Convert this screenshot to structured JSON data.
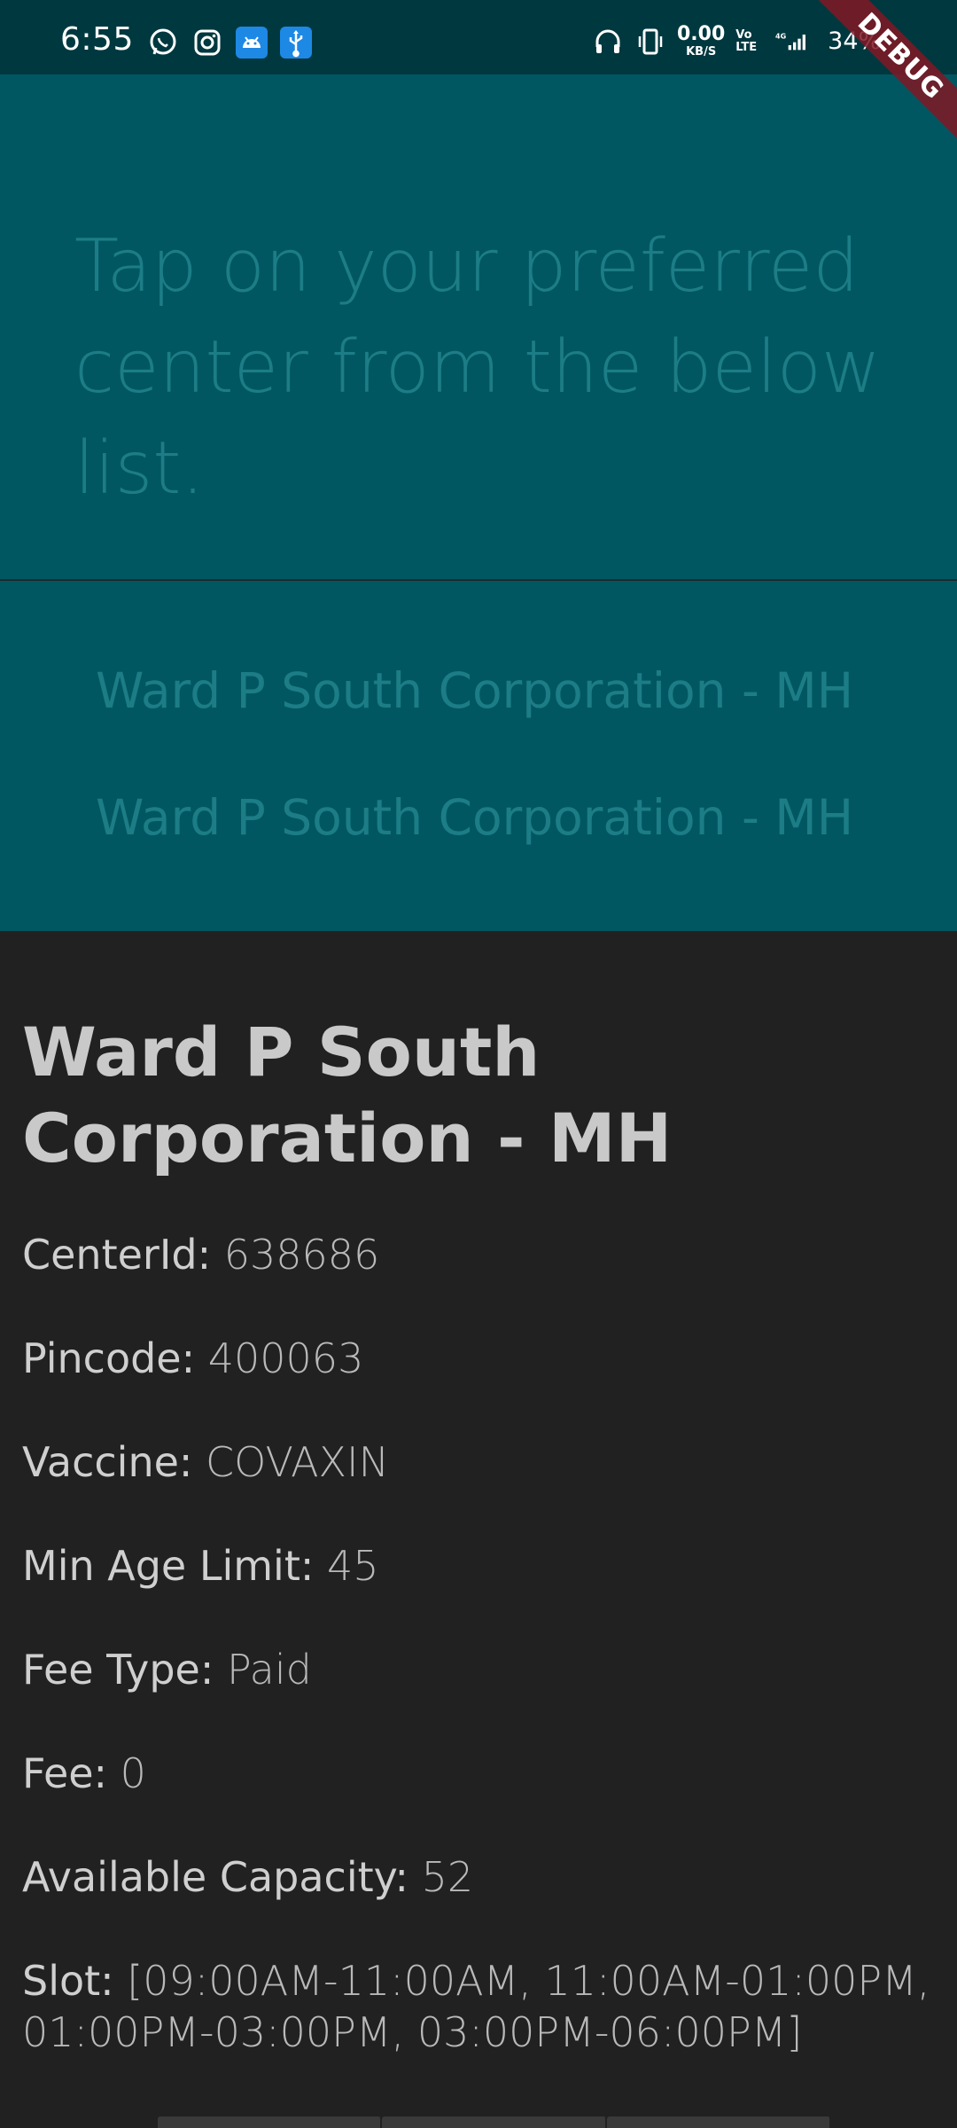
{
  "status_bar": {
    "time": "6:55",
    "notification_icons": [
      "whatsapp-icon",
      "instagram-icon",
      "android-icon",
      "usb-icon"
    ],
    "speed_value": "0.00",
    "speed_unit": "KB/S",
    "volte_top": "Vo",
    "volte_bottom": "LTE",
    "network": "4G",
    "battery": "34%"
  },
  "debug_banner": "DEBUG",
  "header": {
    "instruction": "Tap on your preferred center from the below list."
  },
  "centers": [
    {
      "name": "Ward P South Corporation - MH"
    },
    {
      "name": "Ward P South Corporation - MH"
    }
  ],
  "details": {
    "title": "Ward P South Corporation - MH",
    "rows": [
      {
        "label": "CenterId:",
        "value": "638686"
      },
      {
        "label": "Pincode:",
        "value": "400063"
      },
      {
        "label": "Vaccine:",
        "value": "COVAXIN"
      },
      {
        "label": "Min Age Limit:",
        "value": "45"
      },
      {
        "label": "Fee Type:",
        "value": "Paid"
      },
      {
        "label": "Fee:",
        "value": "0"
      },
      {
        "label": "Available Capacity:",
        "value": "52"
      },
      {
        "label": "Slot:",
        "value": "[09:00AM-11:00AM, 11:00AM-01:00PM, 01:00PM-03:00PM, 03:00PM-06:00PM]"
      }
    ]
  },
  "colors": {
    "status_bar": "#00383f",
    "header_bg": "#015761",
    "header_text": "#1c7d86",
    "detail_bg": "#212121",
    "detail_text": "#c4c4c4",
    "debug_ribbon": "#801824"
  }
}
